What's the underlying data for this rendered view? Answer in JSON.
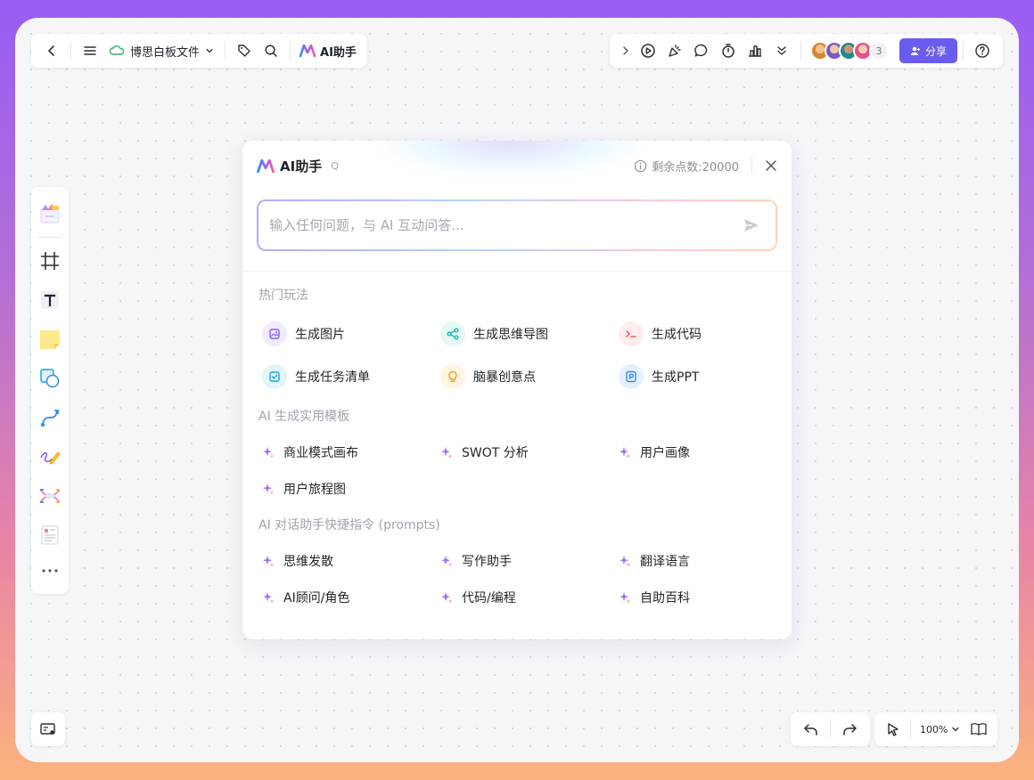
{
  "toolbar_left": {
    "file_name": "博思白板文件",
    "ai_label": "AI助手"
  },
  "toolbar_right": {
    "collaborator_count": "3",
    "share_label": "分享"
  },
  "zoom": {
    "level": "100%"
  },
  "dialog": {
    "title": "AI助手",
    "shortcut_hint": "Q",
    "points_label": "剩余点数:20000",
    "input_placeholder": "输入任何问题，与 AI 互动问答...",
    "sections": {
      "hot": {
        "title": "热门玩法",
        "items": [
          {
            "label": "生成图片",
            "icon": "image-icon",
            "color": "#8b5cf6",
            "bg": "#f1ebff"
          },
          {
            "label": "生成思维导图",
            "icon": "mindmap-icon",
            "color": "#19b8a8",
            "bg": "#e4f8f5"
          },
          {
            "label": "生成代码",
            "icon": "code-icon",
            "color": "#f15b5b",
            "bg": "#ffecec"
          },
          {
            "label": "生成任务清单",
            "icon": "checklist-icon",
            "color": "#1fa6d8",
            "bg": "#e3f4fb"
          },
          {
            "label": "脑暴创意点",
            "icon": "bulb-icon",
            "color": "#f2a114",
            "bg": "#fff4df"
          },
          {
            "label": "生成PPT",
            "icon": "ppt-icon",
            "color": "#2d8cf0",
            "bg": "#e4f0fd"
          }
        ]
      },
      "templates": {
        "title": "AI 生成实用模板",
        "items": [
          "商业模式画布",
          "SWOT 分析",
          "用户画像",
          "用户旅程图"
        ]
      },
      "prompts": {
        "title": "AI 对话助手快捷指令 (prompts)",
        "items": [
          "思维发散",
          "写作助手",
          "翻译语言",
          "AI顾问/角色",
          "代码/编程",
          "自助百科"
        ]
      }
    }
  },
  "colors": {
    "accent": "#6b5cf0",
    "spark": "#a06ef5"
  }
}
